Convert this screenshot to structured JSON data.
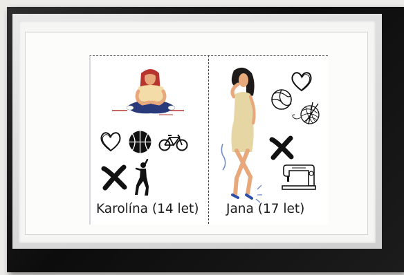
{
  "people": [
    {
      "name_label": "Karolína (14 let)",
      "likes": [
        "heart",
        "basketball",
        "bicycle"
      ],
      "dislikes": [
        "dancer"
      ]
    },
    {
      "name_label": "Jana (17 let)",
      "likes": [
        "heart",
        "volleyball",
        "yarn-ball"
      ],
      "dislikes": [
        "sewing-machine"
      ]
    }
  ],
  "colors": {
    "frame": "#111111",
    "mat": "#f5f5f4",
    "card": "#ffffff",
    "hair_red": "#b8352d",
    "shirt_cream": "#f3dca8",
    "jeans_navy": "#283a7a",
    "dress_beige": "#e6d6a4",
    "skin": "#e7a97b",
    "hair_dark": "#1e1a1a"
  }
}
